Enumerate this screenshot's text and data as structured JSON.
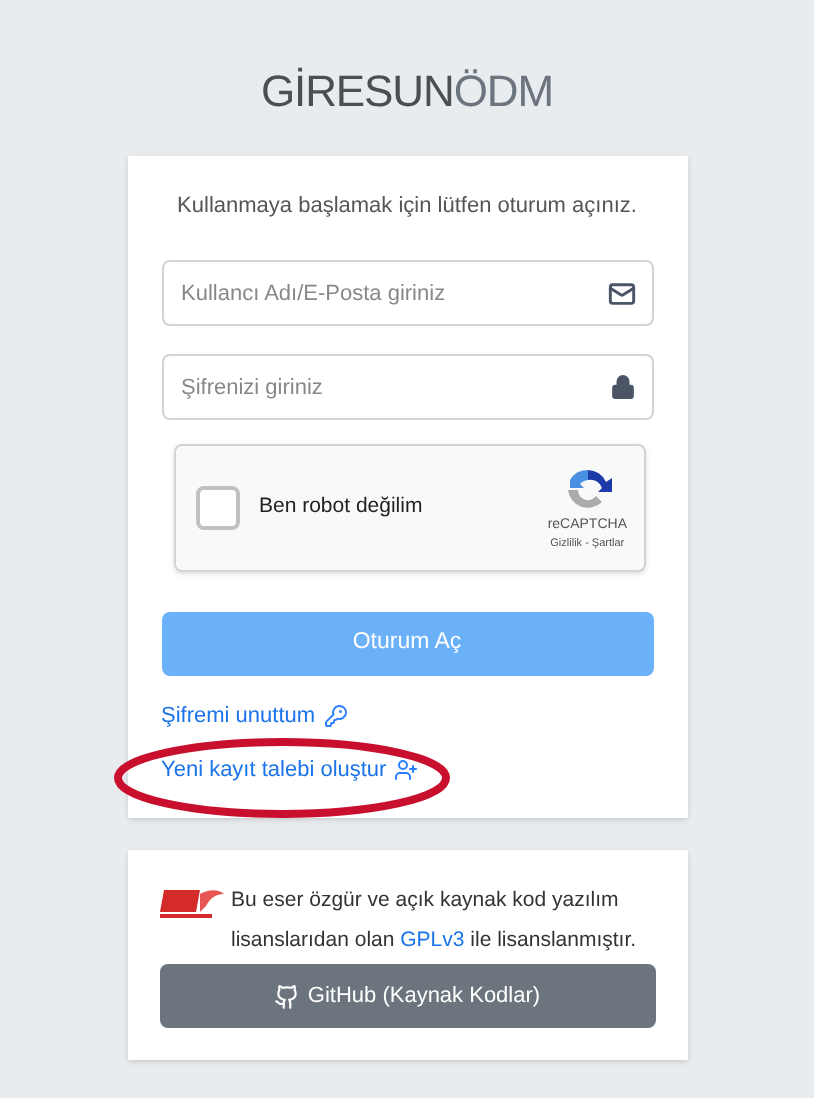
{
  "brand": {
    "strong": "GİRESUN",
    "light": "ÖDM"
  },
  "login": {
    "message": "Kullanmaya başlamak için lütfen oturum açınız.",
    "fields": [
      {
        "kind": "email",
        "placeholder": "Kullancı Adı/E-Posta giriniz"
      },
      {
        "kind": "password",
        "placeholder": "Şifrenizi giriniz"
      }
    ],
    "captcha": {
      "label": "Ben robot değilim",
      "checked": false,
      "brand": "reCAPTCHA",
      "terms": "Gizlilik - Şartlar"
    },
    "submit": "Oturum Aç",
    "links": [
      {
        "kind": "reset",
        "label": "Şifremi unuttum"
      },
      {
        "kind": "register",
        "label": "Yeni kayıt talebi oluştur"
      }
    ]
  },
  "license": {
    "before": "Bu eser özgür ve açık kaynak kod yazılım lisanslarıdan olan",
    "link": "GPLv3",
    "after": "ile lisanslanmıştır.",
    "button": "GitHub (Kaynak Kodlar)"
  }
}
